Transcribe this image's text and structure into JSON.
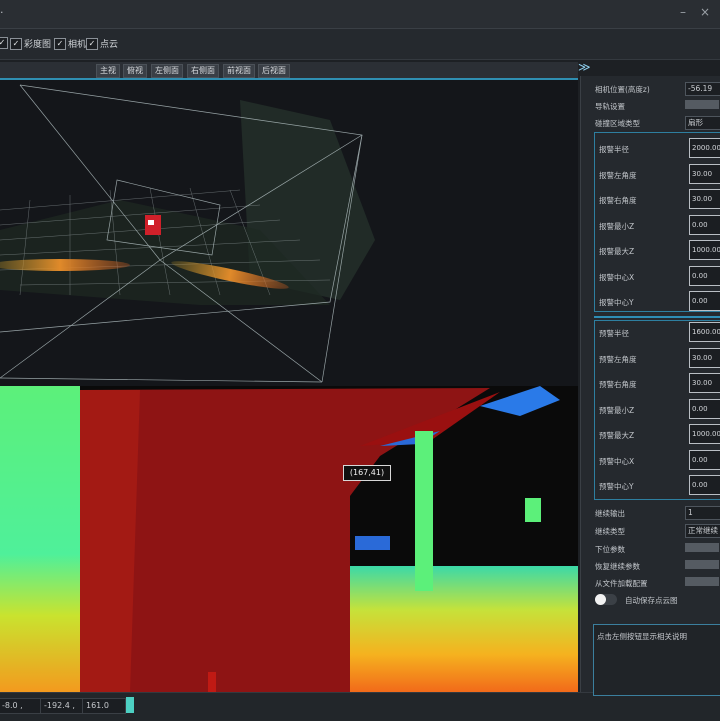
{
  "window": {
    "title_glyph": "·"
  },
  "toolbar": {
    "checks": [
      {
        "label": "",
        "checked": true
      },
      {
        "label": "彩度图",
        "checked": true
      },
      {
        "label": "相机",
        "checked": true
      },
      {
        "label": "点云",
        "checked": true
      }
    ]
  },
  "view_buttons": [
    "主视",
    "俯视",
    "左侧面",
    "右侧面",
    "前视面",
    "后视面"
  ],
  "collapse_glyph": "≫",
  "depth": {
    "hover_coord": "(167,41)"
  },
  "status": {
    "field1": "-8.0 ,",
    "field2": "-192.4 ,",
    "field3": "161.0",
    "progress_fraction": 0.05
  },
  "panel": {
    "camera_position_label": "相机位置(高度z)",
    "camera_position_value": "-56.19",
    "floor_label": "导轨设置",
    "detect_type_label": "碰撞区域类型",
    "detect_type_value": "扇形",
    "group1": [
      {
        "label": "报警半径",
        "value": "2000.00"
      },
      {
        "label": "报警左角度",
        "value": "30.00"
      },
      {
        "label": "报警右角度",
        "value": "30.00"
      },
      {
        "label": "报警最小Z",
        "value": "0.00"
      },
      {
        "label": "报警最大Z",
        "value": "1000.00"
      },
      {
        "label": "报警中心X",
        "value": "0.00"
      },
      {
        "label": "报警中心Y",
        "value": "0.00"
      }
    ],
    "group2": [
      {
        "label": "预警半径",
        "value": "1600.00"
      },
      {
        "label": "预警左角度",
        "value": "30.00"
      },
      {
        "label": "预警右角度",
        "value": "30.00"
      },
      {
        "label": "预警最小Z",
        "value": "0.00"
      },
      {
        "label": "预警最大Z",
        "value": "1000.00"
      },
      {
        "label": "预警中心X",
        "value": "0.00"
      },
      {
        "label": "预警中心Y",
        "value": "0.00"
      }
    ],
    "output_label": "继续输出",
    "output_value": "1",
    "mode_label": "继续类型",
    "mode_value": "正常继续",
    "down_label": "下位参数",
    "restore_label": "恢复继续参数",
    "file_label": "从文件加载配置",
    "save_label": "自动保存点云图",
    "note_text": "点击左侧按钮显示相关说明"
  },
  "colors": {
    "accent": "#2e8db5",
    "panel_bg": "#25292e",
    "view_bg": "#14161a"
  }
}
